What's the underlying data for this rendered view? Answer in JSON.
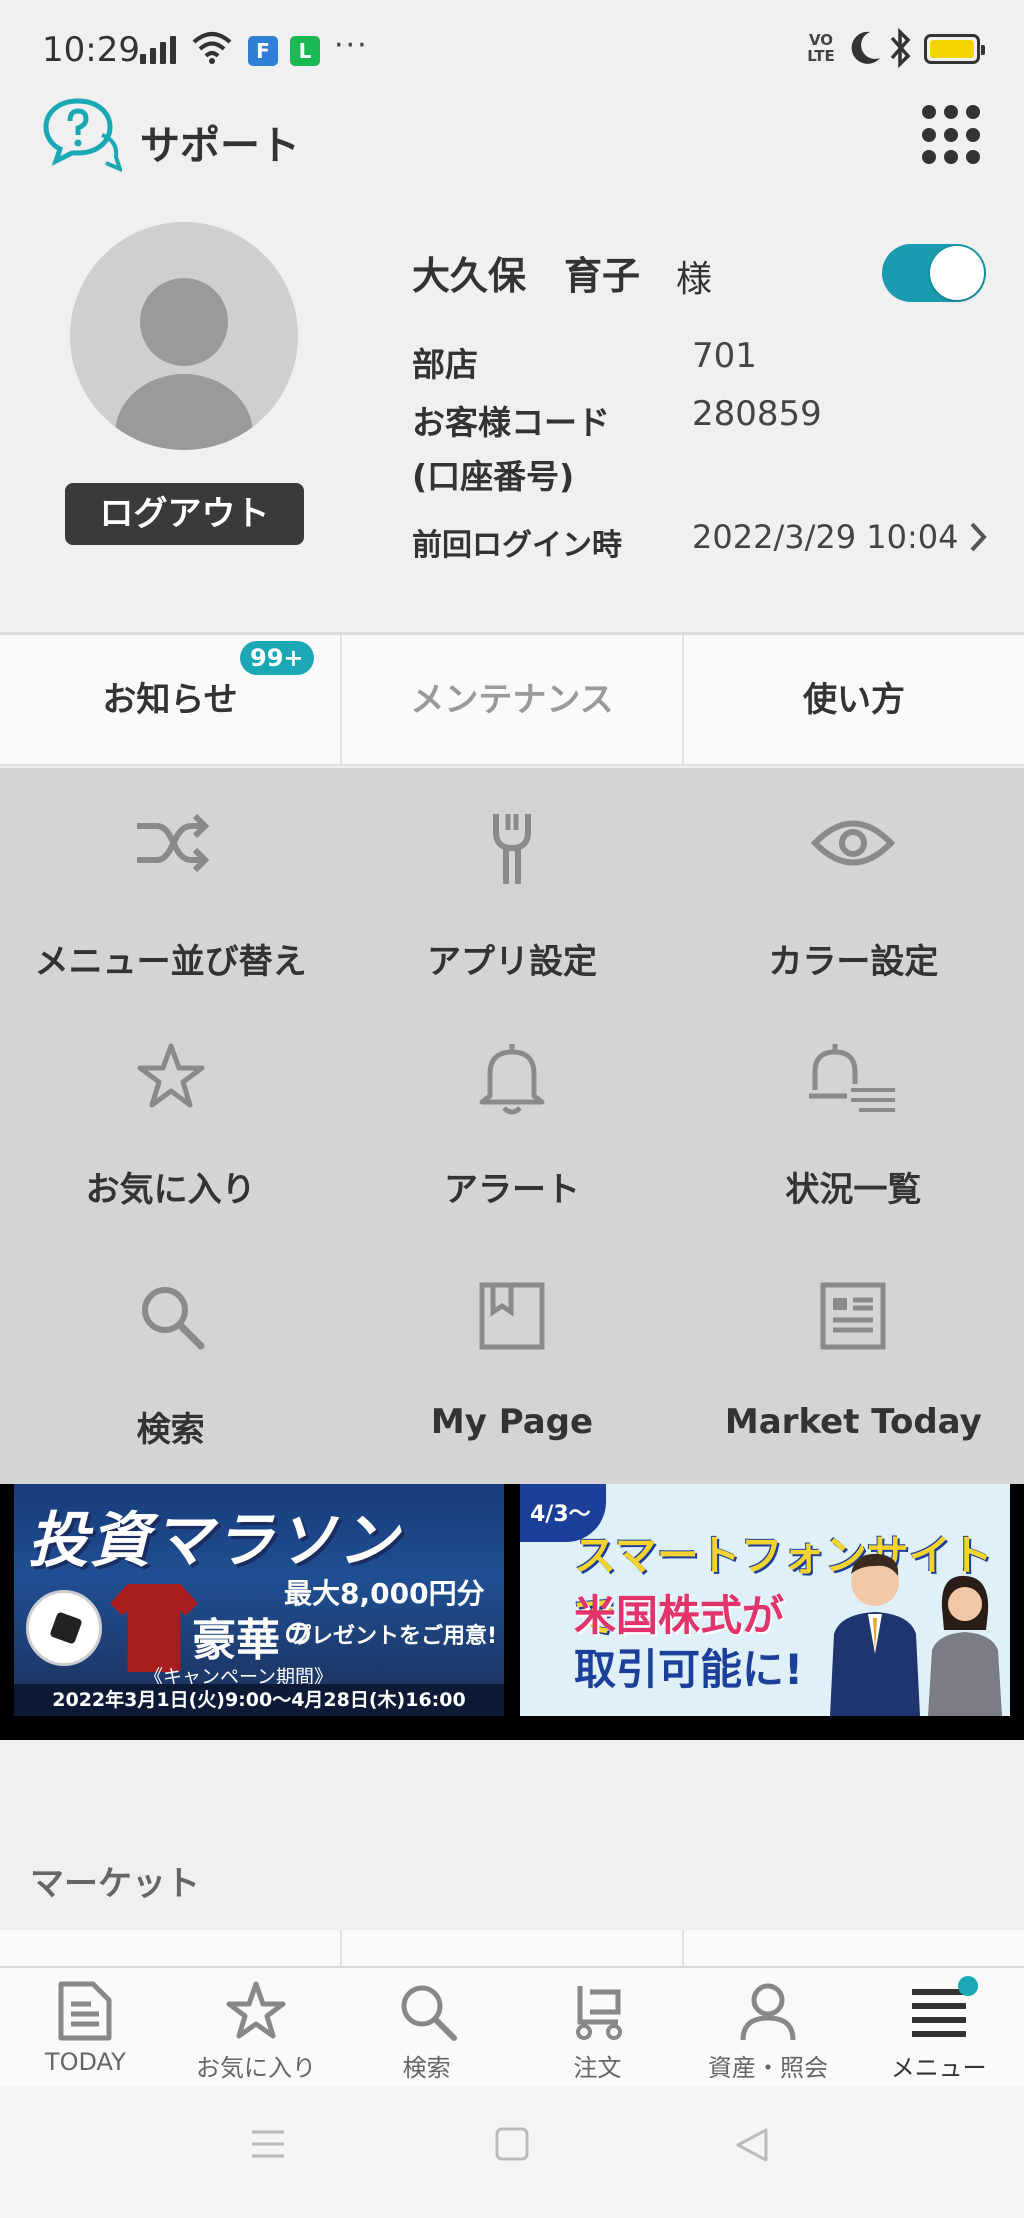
{
  "status_bar": {
    "time": "10:29",
    "more": "···",
    "volte": "VO\nLTE",
    "battery_color": "#f3d300"
  },
  "header": {
    "title": "サポート",
    "icon": "support-chat-icon",
    "accent_color": "#1aa8b5"
  },
  "profile": {
    "name": "大久保　育子",
    "honorific": "様",
    "logout_label": "ログアウト",
    "toggle_on": true,
    "branch_label": "部店",
    "branch_value": "701",
    "customer_code_label": "お客様コード",
    "customer_code_sub": "(口座番号)",
    "customer_code_value": "280859",
    "last_login_label": "前回ログイン時",
    "last_login_value": "2022/3/29 10:04"
  },
  "tabs": [
    {
      "label": "お知らせ",
      "badge": "99+"
    },
    {
      "label": "メンテナンス"
    },
    {
      "label": "使い方"
    }
  ],
  "menu": [
    {
      "label": "メニュー並び替え",
      "icon": "shuffle-icon"
    },
    {
      "label": "アプリ設定",
      "icon": "wrench-icon"
    },
    {
      "label": "カラー設定",
      "icon": "eye-icon"
    },
    {
      "label": "お気に入り",
      "icon": "star-icon"
    },
    {
      "label": "アラート",
      "icon": "bell-icon"
    },
    {
      "label": "状況一覧",
      "icon": "bell-list-icon"
    },
    {
      "label": "検索",
      "icon": "search-icon"
    },
    {
      "label": "My Page",
      "icon": "bookmark-icon"
    },
    {
      "label": "Market Today",
      "icon": "news-icon"
    }
  ],
  "banners": {
    "marathon": {
      "title": "投資マラソン",
      "max_prize": "最大8,000円分の",
      "gorgeous": "豪華",
      "present": "プレゼントをご用意!",
      "period_label": "《キャンペーン期間》",
      "period": "2022年3月1日(火)9:00～4月28日(木)16:00"
    },
    "us_stocks": {
      "date": "4/3～",
      "line1": "スマートフォンサイトで",
      "line2": "米国株式が",
      "line3": "取引可能に!"
    }
  },
  "market": {
    "title": "マーケット"
  },
  "bottom_nav": [
    {
      "label": "TODAY",
      "icon": "document-icon"
    },
    {
      "label": "お気に入り",
      "icon": "star-icon"
    },
    {
      "label": "検索",
      "icon": "search-icon"
    },
    {
      "label": "注文",
      "icon": "cart-icon"
    },
    {
      "label": "資産・照会",
      "icon": "person-icon"
    },
    {
      "label": "メニュー",
      "icon": "menu-list-icon",
      "active": true
    }
  ]
}
